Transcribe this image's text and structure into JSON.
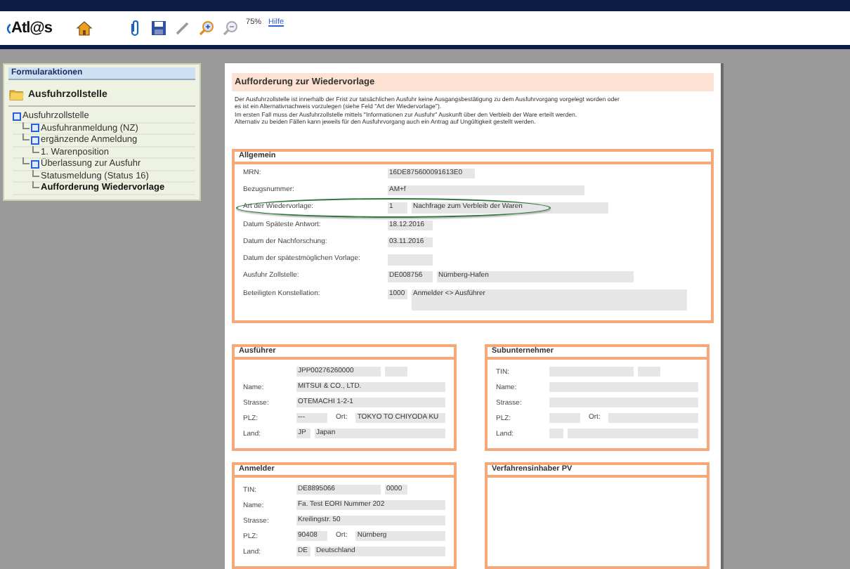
{
  "toolbar": {
    "logo": "Atl@s",
    "zoom": "75%",
    "help_link": "Hilfe"
  },
  "sidebar": {
    "title": "Formularaktionen",
    "section": "Ausfuhrzollstelle",
    "tree": [
      {
        "label": "Ausfuhrzollstelle",
        "expandable": true,
        "selected": false,
        "children": [
          {
            "label": "Ausfuhranmeldung (NZ)",
            "expandable": true,
            "selected": false
          },
          {
            "label": "ergänzende Anmeldung",
            "expandable": true,
            "selected": false,
            "children": [
              {
                "label": "1. Warenposition",
                "expandable": false,
                "selected": false
              }
            ]
          },
          {
            "label": "Überlassung zur Ausfuhr",
            "expandable": true,
            "selected": false,
            "children": [
              {
                "label": "Statusmeldung (Status 16)",
                "expandable": false,
                "selected": false
              },
              {
                "label": "Aufforderung Wiedervorlage",
                "expandable": false,
                "selected": true
              }
            ]
          }
        ]
      }
    ]
  },
  "document": {
    "title": "Aufforderung zur Wiedervorlage",
    "intro": [
      "Der Ausfuhrzollstelle ist innerhalb der Frist zur tatsächlichen Ausfuhr keine Ausgangsbestätigung zu dem Ausfuhrvorgang vorgelegt worden oder",
      "es ist ein Alternativnachweis vorzulegen (siehe Feld \"Art der Wiedervorlage\").",
      "Im ersten Fall muss der Ausfuhrzollstelle mittels \"Informationen zur Ausfuhr\" Auskunft über den Verbleib der Ware erteilt werden.",
      "Alternativ zu beiden Fällen kann jeweils für den Ausfuhrvorgang auch ein Antrag auf Ungültigkeit gestellt werden."
    ],
    "general": {
      "title": "Allgemein",
      "rows": [
        {
          "label": "MRN:",
          "highlighted": false,
          "fields": [
            {
              "kind": "medium",
              "value": "16DE875600091613E0"
            }
          ]
        },
        {
          "label": "Bezugsnummer:",
          "highlighted": false,
          "fields": [
            {
              "kind": "long",
              "value": "AM+f"
            }
          ]
        },
        {
          "label": "Art der Wiedervorlage:",
          "highlighted": true,
          "fields": [
            {
              "kind": "tiny",
              "value": "1"
            },
            {
              "kind": "long",
              "value": "Nachfrage zum Verbleib der Waren"
            }
          ]
        },
        {
          "label": "Datum Späteste Antwort:",
          "highlighted": false,
          "fields": [
            {
              "kind": "short",
              "value": "18.12.2016"
            }
          ]
        },
        {
          "label": "Datum der Nachforschung:",
          "highlighted": false,
          "fields": [
            {
              "kind": "short",
              "value": "03.11.2016"
            }
          ]
        },
        {
          "label": "Datum der spätestmöglichen Vorlage:",
          "highlighted": false,
          "fields": [
            {
              "kind": "short"
            }
          ]
        },
        {
          "label": "Ausfuhr Zollstelle:",
          "highlighted": false,
          "fields": [
            {
              "kind": "short",
              "value": "DE008756"
            },
            {
              "kind": "long",
              "value": "Nürnberg-Hafen"
            }
          ]
        },
        {
          "label": "Beteiligten Konstellation:",
          "highlighted": false,
          "fields": [
            {
              "kind": "tiny",
              "value": "1000"
            },
            {
              "kind": "area",
              "value": "Anmelder <> Ausführer"
            }
          ]
        }
      ]
    },
    "parties": [
      {
        "title": "Ausführer",
        "rows": [
          {
            "fields": [
              {
                "kind": "medium",
                "value": "JPP00276260000"
              },
              {
                "kind": "small"
              }
            ]
          },
          {
            "label": "Name:",
            "fields": [
              {
                "kind": "long",
                "value": "MITSUI & CO., LTD."
              }
            ]
          },
          {
            "label": "Strasse:",
            "fields": [
              {
                "kind": "long",
                "value": "OTEMACHI 1-2-1"
              }
            ]
          },
          {
            "label": "PLZ:",
            "fields": [
              {
                "kind": "short",
                "value": "---"
              },
              {
                "kind": "label",
                "value": "Ort:"
              },
              {
                "kind": "rest",
                "value": "TOKYO TO CHIYODA KU"
              }
            ]
          },
          {
            "label": "Land:",
            "fields": [
              {
                "kind": "tiny",
                "value": "JP"
              },
              {
                "kind": "rest",
                "value": "Japan"
              }
            ]
          }
        ]
      },
      {
        "title": "Subunternehmer",
        "rows": [
          {
            "label": "TIN:",
            "fields": [
              {
                "kind": "medium"
              },
              {
                "kind": "small"
              }
            ]
          },
          {
            "label": "Name:",
            "fields": [
              {
                "kind": "long"
              }
            ]
          },
          {
            "label": "Strasse:",
            "fields": [
              {
                "kind": "long"
              }
            ]
          },
          {
            "label": "PLZ:",
            "fields": [
              {
                "kind": "short"
              },
              {
                "kind": "label",
                "value": "Ort:"
              },
              {
                "kind": "rest"
              }
            ]
          },
          {
            "label": "Land:",
            "fields": [
              {
                "kind": "tiny"
              },
              {
                "kind": "rest"
              }
            ]
          }
        ]
      },
      {
        "title": "Anmelder",
        "rows": [
          {
            "label": "TIN:",
            "fields": [
              {
                "kind": "medium",
                "value": "DE8895066"
              },
              {
                "kind": "small",
                "value": "0000"
              }
            ]
          },
          {
            "label": "Name:",
            "fields": [
              {
                "kind": "long",
                "value": "Fa. Test EORI Nummer 202"
              }
            ]
          },
          {
            "label": "Strasse:",
            "fields": [
              {
                "kind": "long",
                "value": "Kreilingstr. 50"
              }
            ]
          },
          {
            "label": "PLZ:",
            "fields": [
              {
                "kind": "short",
                "value": "90408"
              },
              {
                "kind": "label",
                "value": "Ort:"
              },
              {
                "kind": "rest",
                "value": "Nürnberg"
              }
            ]
          },
          {
            "label": "Land:",
            "fields": [
              {
                "kind": "tiny",
                "value": "DE"
              },
              {
                "kind": "rest",
                "value": "Deutschland"
              }
            ]
          }
        ]
      },
      {
        "title": "Verfahrensinhaber PV"
      }
    ]
  }
}
